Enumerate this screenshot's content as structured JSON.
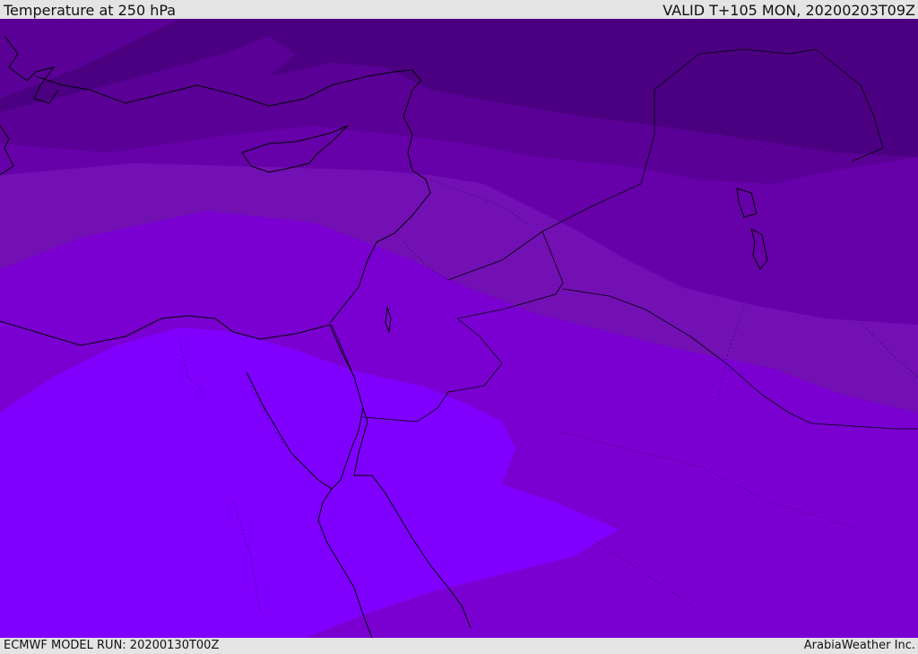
{
  "header": {
    "title": "Temperature at 250 hPa",
    "valid_time": "VALID T+105 MON, 20200203T09Z"
  },
  "footer": {
    "model_run": "ECMWF MODEL RUN: 20200130T00Z",
    "credit": "ArabiaWeather Inc."
  },
  "map": {
    "field": "temperature",
    "level_hpa": 250,
    "band_colors": [
      "#4b0082",
      "#5a0096",
      "#6600a8",
      "#7210b4",
      "#7a00d2",
      "#7f00ff"
    ],
    "coastline_color": "#000000"
  }
}
